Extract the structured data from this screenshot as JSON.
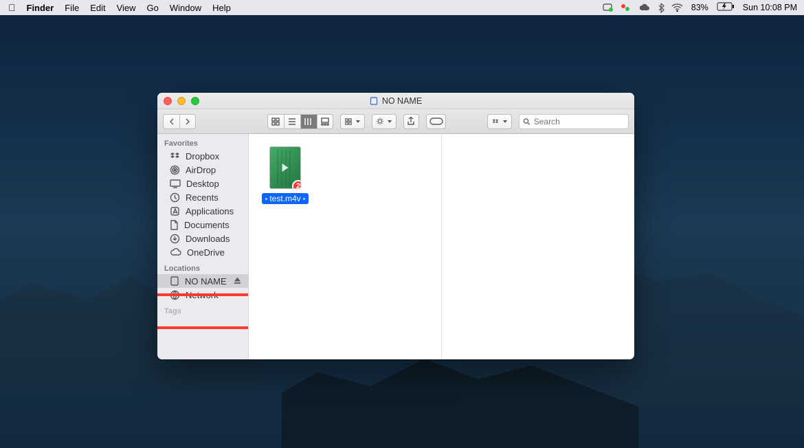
{
  "menubar": {
    "app_name": "Finder",
    "items": [
      "File",
      "Edit",
      "View",
      "Go",
      "Window",
      "Help"
    ],
    "battery_pct": "83%",
    "clock": "Sun 10:08 PM"
  },
  "window": {
    "title": "NO NAME"
  },
  "toolbar": {
    "search_placeholder": "Search"
  },
  "sidebar": {
    "sections": [
      {
        "label": "Favorites",
        "items": [
          {
            "icon": "dropbox",
            "label": "Dropbox"
          },
          {
            "icon": "airdrop",
            "label": "AirDrop"
          },
          {
            "icon": "desktop",
            "label": "Desktop"
          },
          {
            "icon": "recents",
            "label": "Recents"
          },
          {
            "icon": "applications",
            "label": "Applications"
          },
          {
            "icon": "documents",
            "label": "Documents"
          },
          {
            "icon": "downloads",
            "label": "Downloads"
          },
          {
            "icon": "onedrive",
            "label": "OneDrive"
          }
        ]
      },
      {
        "label": "Locations",
        "items": [
          {
            "icon": "drive",
            "label": "NO NAME",
            "selected": true,
            "ejectable": true
          },
          {
            "icon": "network",
            "label": "Network"
          }
        ]
      },
      {
        "label": "Tags",
        "items": []
      }
    ]
  },
  "files": [
    {
      "name": "test.m4v",
      "badge": "2",
      "selected": true
    }
  ],
  "annotation": {
    "highlight_sidebar_location": true
  }
}
